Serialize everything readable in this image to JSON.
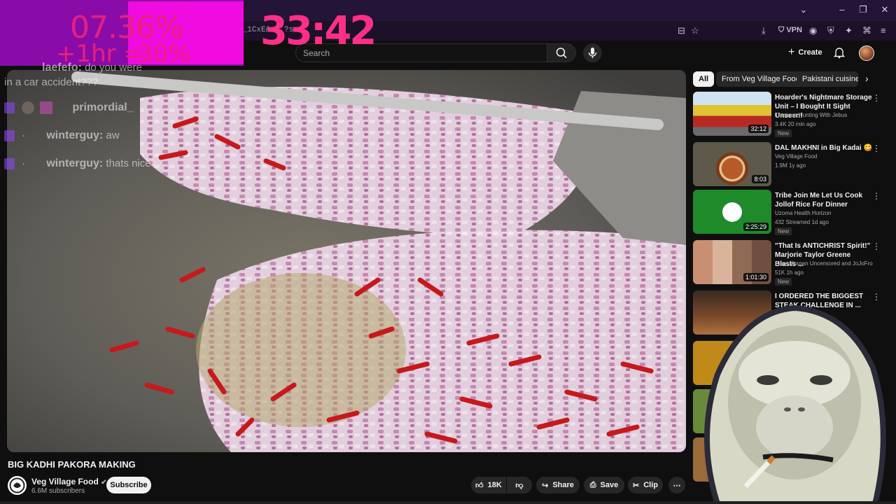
{
  "browser": {
    "url_fragment": "l_1CxE&...?s",
    "vpn_label": "VPN"
  },
  "overlay": {
    "stat_percent": "07.36%",
    "stat_sub_left": "+1hr =",
    "stat_sub_right": "30%",
    "timer": "33:42",
    "chat": [
      {
        "user": "laefefo:",
        "text": "do you were"
      },
      {
        "user": "",
        "text": "in a car accident???"
      },
      {
        "user": "primordial_",
        "text": ""
      },
      {
        "user": "winterguy:",
        "text": "aw"
      },
      {
        "user": "winterguy:",
        "text": "thats nice"
      }
    ]
  },
  "header": {
    "search_placeholder": "Search",
    "create_label": "Create"
  },
  "video": {
    "title": "BIG KADHI PAKORA MAKING",
    "channel": "Veg Village Food",
    "subscribers": "6.6M subscribers",
    "subscribe_label": "Subscribe",
    "likes": "18K",
    "share_label": "Share",
    "save_label": "Save",
    "clip_label": "Clip"
  },
  "chips": [
    "All",
    "From Veg Village Food",
    "Pakistani cuisine"
  ],
  "recommendations": [
    {
      "title": "Hoarder's Nightmare Storage Unit – I Bought It Sight Unseen!",
      "channel": "Treasure Hunting With Jebus",
      "meta": "3.4K  20 min ago",
      "badge": "New",
      "duration": "32:12"
    },
    {
      "title": "DAL MAKHNI in Big Kadai 😋",
      "channel": "Veg Village Food",
      "meta": "1.9M  1y ago",
      "badge": "",
      "duration": "8:03"
    },
    {
      "title": "Tribe Join Me Let Us Cook Jollof Rice For Dinner",
      "channel": "Uzoma Health Horizon",
      "meta": "432  Streamed 1d ago",
      "badge": "New",
      "duration": "2:25:29"
    },
    {
      "title": "\"That Is ANTICHRIST Spirit!\" Marjorie Taylor Greene Blasts ...",
      "channel": "Piers Morgan Uncensored",
      "channel_extra": "and JoJoFro",
      "meta": "51K  1h ago",
      "badge": "New",
      "duration": "1:01:30"
    },
    {
      "title": "I ORDERED THE BIGGEST STEAK CHALLENGE IN ...",
      "channel": "",
      "meta": "",
      "badge": "",
      "duration": ""
    }
  ],
  "colors": {
    "background": "#0f0f0f",
    "overlay_purple": "#8a0ca8",
    "overlay_magenta": "#f00ce0",
    "timer_pink": "#ff2f88",
    "twitch": "#9146ff"
  }
}
